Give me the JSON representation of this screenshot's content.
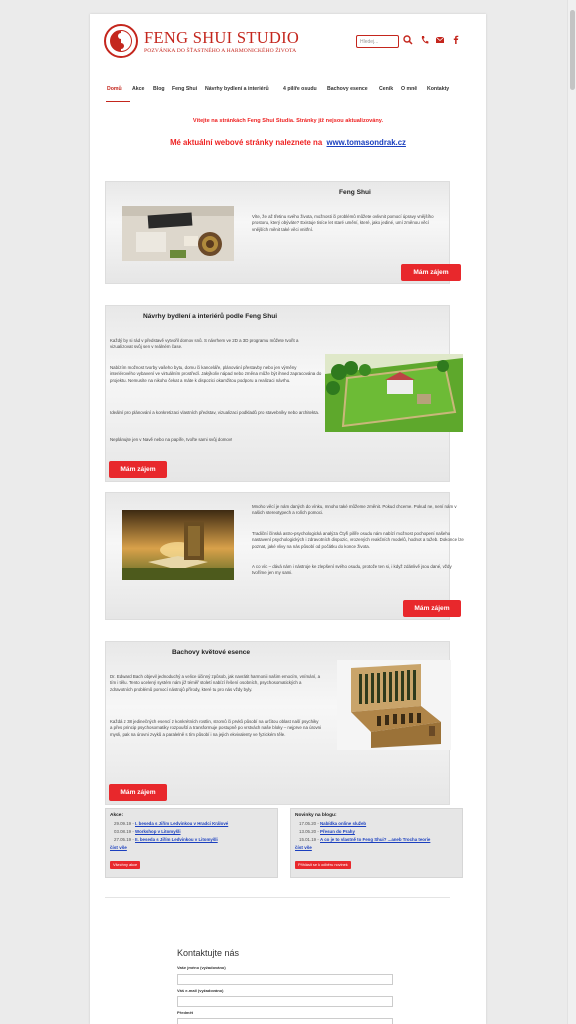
{
  "brand": {
    "title": "FENG SHUI STUDIO",
    "subtitle": "POZVÁNKA DO ŠŤASTNÉHO A HARMONICKÉHO ŽIVOTA",
    "accent": "#c4261d"
  },
  "header": {
    "search_placeholder": "Hledej...",
    "icons": [
      "search-icon",
      "phone-icon",
      "email-icon",
      "facebook-icon"
    ]
  },
  "nav": {
    "items": [
      "Domů",
      "Akce",
      "Blog",
      "Feng Shui",
      "Návrhy bydlení a interiérů",
      "4 pilíře osudu",
      "Bachovy esence",
      "Ceník",
      "O mně",
      "Kontakty"
    ],
    "active": "Domů"
  },
  "notice": {
    "line1": "Vítejte na stránkách Feng Shui Studia. Stránky již nejsou aktualizovány.",
    "line2_prefix": "Mé aktuální webové stránky naleznete na",
    "link": "www.tomasondrak.cz"
  },
  "sections": [
    {
      "title": "Feng Shui",
      "text": "Víte, že až třetinu svého života, možnosti či problémů můžete ovlivnit pomocí úpravy vnějšího prostoru, který obýváte? Existuje tisíce let staré umění, které, jako jediné, umí změnou věcí vnějších měnit také věci vnitřní.",
      "button": "Mám zájem"
    },
    {
      "title": "Návrhy bydlení a interiérů podle Feng Shui",
      "p1": "Každý by si rád v představě vytvořil domov snů. S návrhem ve 2D a 3D programu můžete tvořit a vizualizovat svůj sen v reálném čase.",
      "p2": "Nabízím možnost tvorby vašeho bytu, domu či kanceláře, plánování přestavby nebo jen výměny interiérového vybavení ve virtuálním prostředí. Jakýkoliv nápad nebo změna může být ihned zapracována do projektu. Nemusíte na nikoho čekat a máte k dispozici okamžitou podporu a realizaci návrhu.",
      "p3": "Ideální pro plánování a konkretizaci vlastních představ, vizualizaci podkladů pro stavebníky nebo architekta.",
      "p4": "Neplánujte jen v Navě nebo na papíře, tvořte sami svůj domov!",
      "button": "Mám zájem"
    },
    {
      "p1": "Mnoho věcí je nám daných do vínku, mnoho také můžeme změnit. Pokud chceme. Pokud ne, není nám v našich stereotypech a rolích pomoci.",
      "p2": "Tradiční čínská astro-psychologická analýza Čtyři pilíře osudu nám nabízí možnost pochopení našeho nastavení psychologických i zdravotních dispozic, vrozených reakčních modelů, hodnot a tužeb. Dokonce lze poznat, jaké vlivy na nás působí od počátku do konce života.",
      "p3": "A co víc – dává nám i nástroje ke zlepšení svého osudu, protože ten si, i když zdánlivě jsou dané, vždy tvoříme jen my sami.",
      "button": "Mám zájem"
    },
    {
      "title": "Bachovy květové esence",
      "p1": "Dr. Edward Bach objevil jednoduchý a velice účinný způsob, jak navrátit harmonii našim emocím, vnímání, a tím i tělu. Tento ucelený systém nám již téměř století nabízí řešení osobních, psychosomatických a zdravotních problémů pomocí nástrojů přírody, které tu pro nás vždy byly.",
      "p2": "Každá z 38 jedinečných esencí z konkrétních rostlin, stromů či prvků působí na určitou oblast naší psychiky a přes princip psychosomatiky rozpouští a transformuje postupně po vrstvách naše bloky – nejprve na úrovni mysli, pak na úrovni zvyků a paralelně s tím působí i na jejich ekvivalenty ve fyzickém těle.",
      "button": "Mám zájem"
    }
  ],
  "events": {
    "heading": "Akce:",
    "rows": [
      {
        "date": "29.09.19",
        "title": "I. beseda s Jiřím Ledvinkou v Hradci Králové"
      },
      {
        "date": "03.08.19",
        "title": "Workshop v Litomyšli"
      },
      {
        "date": "27.05.19",
        "title": "II. beseda s Jiřím Ledvinkou v Litomyšli"
      }
    ],
    "more": "číst vše",
    "button": "Všechny akce"
  },
  "blog": {
    "heading": "Novinky na blogu:",
    "rows": [
      {
        "date": "17.05.20",
        "title": "Nabídka online služeb"
      },
      {
        "date": "13.05.20",
        "title": "Přesun do Prahy"
      },
      {
        "date": "15.01.19",
        "title": "A co je to vlastně to Feng Shui? ...aneb Trocha teorie"
      }
    ],
    "more": "číst vše",
    "button": "Přihlásit se k odběru novinek"
  },
  "contact": {
    "title": "Kontaktujte nás",
    "name_label": "Vaše jméno (vyžadováno)",
    "email_label": "Váš e-mail (vyžadováno)",
    "subject_label": "Předmět"
  }
}
